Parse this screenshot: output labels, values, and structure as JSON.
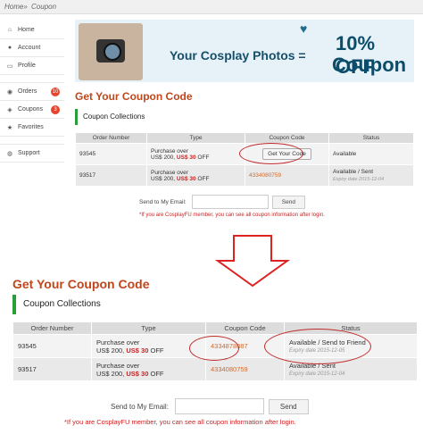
{
  "breadcrumb": {
    "home": "Home»",
    "current": "Coupon"
  },
  "sidebar": {
    "items": [
      {
        "label": "Home",
        "icon": "home-icon"
      },
      {
        "label": "Account",
        "icon": "user-icon"
      },
      {
        "label": "Profile",
        "icon": "profile-icon"
      },
      {
        "label": "Orders",
        "icon": "orders-icon",
        "badge": "10"
      },
      {
        "label": "Coupons",
        "icon": "coupon-icon",
        "badge": "3"
      },
      {
        "label": "Favorites",
        "icon": "star-icon"
      },
      {
        "label": "Support",
        "icon": "support-icon"
      }
    ]
  },
  "banner": {
    "line1": "Your Cosplay Photos =",
    "line2": "10% OFF",
    "line3": "Coupon"
  },
  "section": {
    "title": "Get Your Coupon Code",
    "collections": "Coupon Collections",
    "columns": [
      "Order Number",
      "Type",
      "Coupon Code",
      "Status"
    ],
    "email_label": "Send to My Email:",
    "send": "Send",
    "note": "*If you are CosplayFU member, you can see all coupon information after login."
  },
  "rows_top": [
    {
      "order": "93545",
      "type_line1": "Purchase over",
      "type_line2a": "US$ 200,",
      "type_off": "US$ 30",
      "type_line2b": "OFF",
      "code_button": "Get Your Code",
      "status": "Available",
      "expiry": ""
    },
    {
      "order": "93517",
      "type_line1": "Purchase over",
      "type_line2a": "US$ 200,",
      "type_off": "US$ 30",
      "type_line2b": "OFF",
      "code": "4334080759",
      "status": "Available / Sent",
      "expiry": "Expiry date 2015-12-04"
    }
  ],
  "rows_bottom": [
    {
      "order": "93545",
      "type_line1": "Purchase over",
      "type_line2a": "US$ 200,",
      "type_off": "US$ 30",
      "type_line2b": "OFF",
      "code": "4334878087",
      "status": "Available / Send to Friend",
      "expiry": "Expiry date 2015-12-05"
    },
    {
      "order": "93517",
      "type_line1": "Purchase over",
      "type_line2a": "US$ 200,",
      "type_off": "US$ 30",
      "type_line2b": "OFF",
      "code": "4334080759",
      "status": "Available / Sent",
      "expiry": "Expiry date 2015-12-04"
    }
  ],
  "colors": {
    "title": "#c0461b",
    "accent_green": "#2b9e3c",
    "alert_red": "#cc2222",
    "code_orange": "#d26a2e"
  }
}
